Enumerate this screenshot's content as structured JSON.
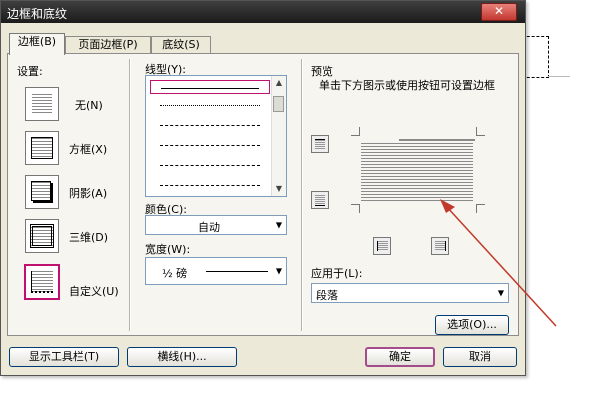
{
  "window": {
    "title": "边框和底纹",
    "close_glyph": "✕"
  },
  "tabs": [
    {
      "label": "边框(B)",
      "active": true
    },
    {
      "label": "页面边框(P)",
      "active": false
    },
    {
      "label": "底纹(S)",
      "active": false
    }
  ],
  "settings": {
    "label": "设置:",
    "items": [
      {
        "label": "无(N)",
        "icon": "setting-none-icon"
      },
      {
        "label": "方框(X)",
        "icon": "setting-box-icon"
      },
      {
        "label": "阴影(A)",
        "icon": "setting-shadow-icon"
      },
      {
        "label": "三维(D)",
        "icon": "setting-3d-icon"
      },
      {
        "label": "自定义(U)",
        "icon": "setting-custom-icon",
        "selected": true
      }
    ]
  },
  "style": {
    "label": "线型(Y):",
    "items": [
      "solid",
      "dotted",
      "dash-dot",
      "dashed",
      "long-dash",
      "dash-dot-dot"
    ],
    "selected_index": 0,
    "color_label": "颜色(C):",
    "color_value": "自动",
    "width_label": "宽度(W):",
    "width_value": "½ 磅"
  },
  "preview": {
    "label": "预览",
    "hint": "单击下方图示或使用按钮可设置边框",
    "apply_label": "应用于(L):",
    "apply_value": "段落",
    "options_button": "选项(O)..."
  },
  "footer": {
    "toolbar_button": "显示工具栏(T)",
    "hline_button": "横线(H)...",
    "ok_button": "确定",
    "cancel_button": "取消"
  },
  "colors": {
    "selected_outline": "#c01070",
    "annotation_arrow": "#c0392b"
  }
}
